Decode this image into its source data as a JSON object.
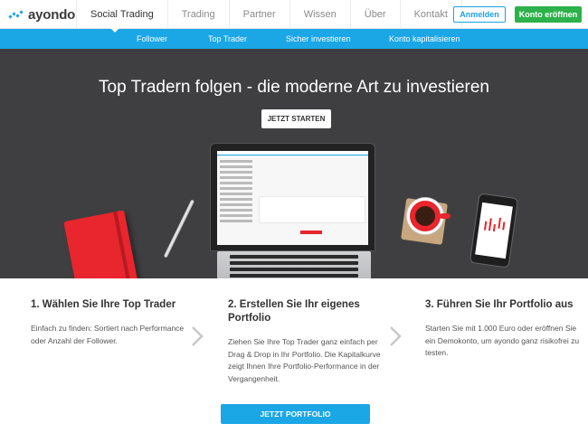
{
  "brand": {
    "name": "ayondo",
    "accent": "#1ba6e6",
    "green": "#2db14a"
  },
  "topnav": {
    "items": [
      {
        "label": "Social Trading",
        "active": true
      },
      {
        "label": "Trading",
        "active": false
      },
      {
        "label": "Partner",
        "active": false
      },
      {
        "label": "Wissen",
        "active": false
      },
      {
        "label": "Über",
        "active": false
      },
      {
        "label": "Kontakt",
        "active": false
      }
    ],
    "login_label": "Anmelden",
    "open_account_label": "Konto eröffnen"
  },
  "subnav": {
    "items": [
      {
        "label": "Follower"
      },
      {
        "label": "Top Trader"
      },
      {
        "label": "Sicher investieren"
      },
      {
        "label": "Konto kapitalisieren"
      }
    ]
  },
  "hero": {
    "title": "Top Tradern folgen - die moderne Art zu investieren",
    "cta_label": "JETZT STARTEN"
  },
  "steps": [
    {
      "title": "1. Wählen Sie Ihre Top Trader",
      "text": "Einfach zu finden: Sortiert nach Performance oder Anzahl der Follower."
    },
    {
      "title": "2. Erstellen Sie Ihr eigenes Portfolio",
      "text": "Ziehen Sie Ihre Top Trader ganz einfach per Drag & Drop in Ihr Portfolio. Die Kapitalkurve zeigt Ihnen Ihre Portfolio-Performance in der Vergangenheit."
    },
    {
      "title": "3. Führen Sie Ihr Portfolio aus",
      "text": "Starten Sie mit 1.000 Euro oder eröffnen Sie ein Demokonto, um ayondo ganz risikofrei zu testen."
    }
  ],
  "portfolio_cta_label": "JETZT PORTFOLIO ZUSAMMENSTELLEN"
}
